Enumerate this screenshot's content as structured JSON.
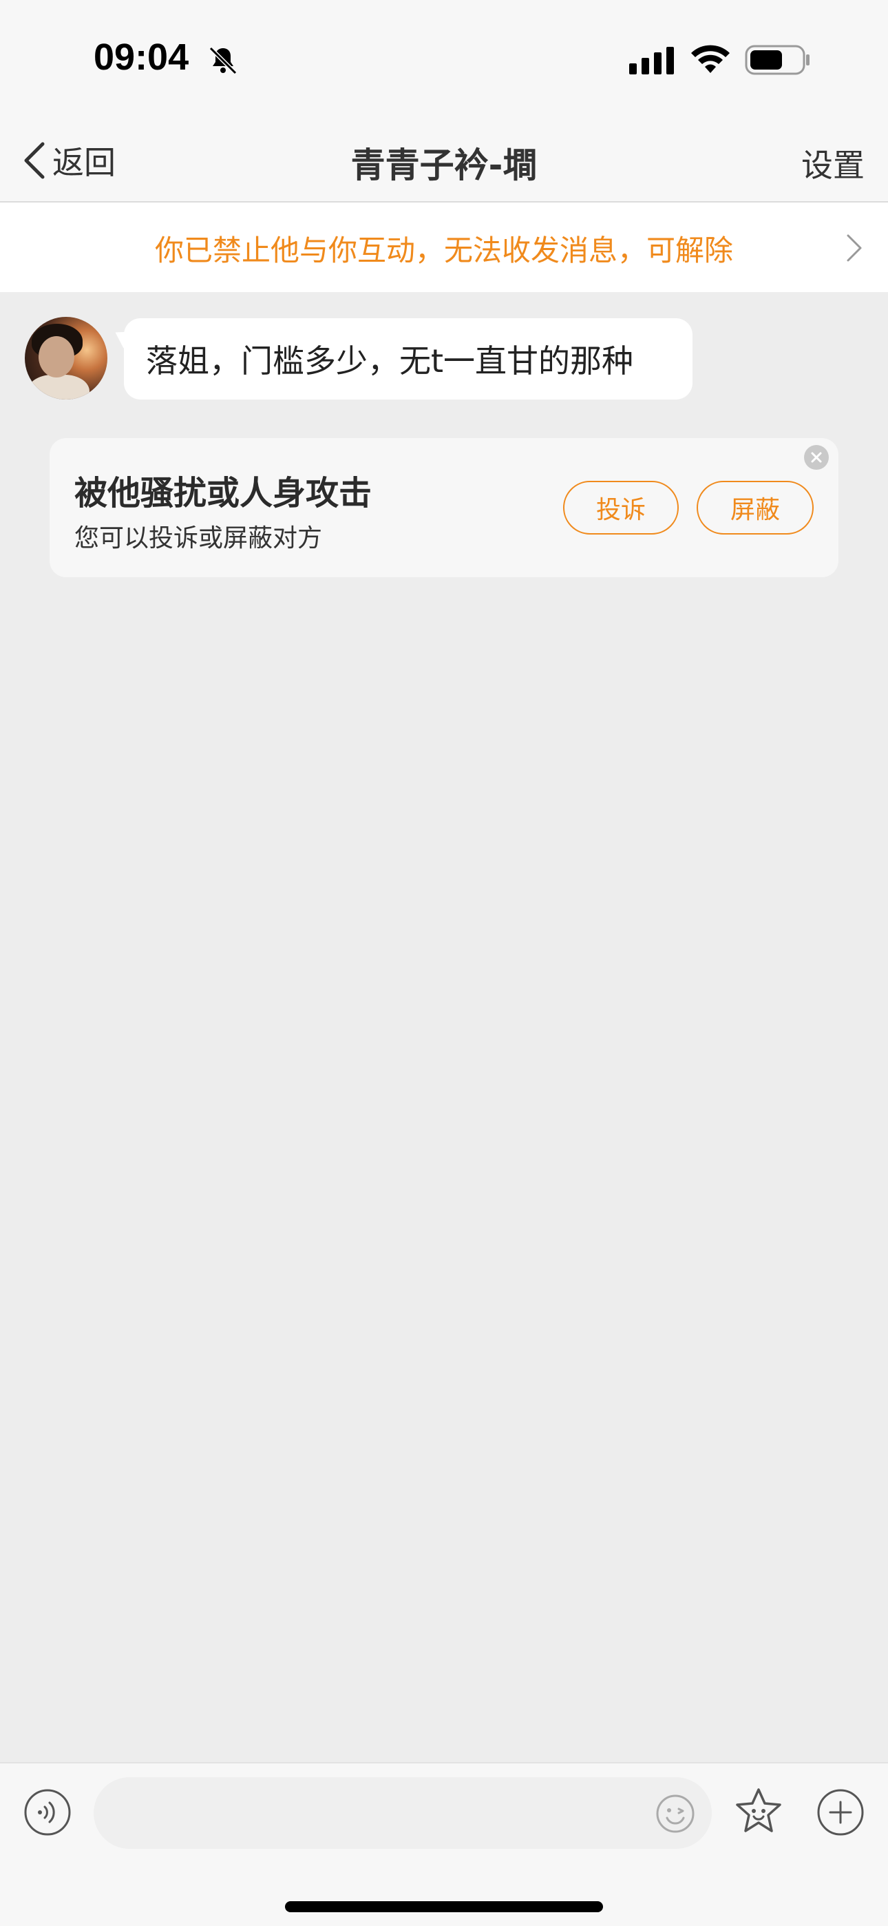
{
  "status_bar": {
    "time": "09:04"
  },
  "nav": {
    "back_label": "返回",
    "title": "青青子衿-墹",
    "settings_label": "设置"
  },
  "banner": {
    "text": "你已禁止他与你互动，无法收发消息，可解除"
  },
  "messages": [
    {
      "text": "落姐，门槛多少，无t一直甘的那种"
    }
  ],
  "harassment_card": {
    "title": "被他骚扰或人身攻击",
    "subtitle": "您可以投诉或屏蔽对方",
    "report_label": "投诉",
    "block_label": "屏蔽"
  },
  "input_bar": {
    "placeholder": ""
  },
  "colors": {
    "accent": "#f08a1c",
    "background": "#ededed"
  },
  "icons": {
    "mute": "bell-slash-icon",
    "signal": "cellular-signal-icon",
    "wifi": "wifi-icon",
    "battery": "battery-icon",
    "back": "chevron-left-icon",
    "banner": "chevron-right-icon",
    "close": "close-icon",
    "voice": "voice-icon",
    "emoji": "emoji-icon",
    "sticker": "sticker-icon",
    "plus": "plus-icon"
  }
}
